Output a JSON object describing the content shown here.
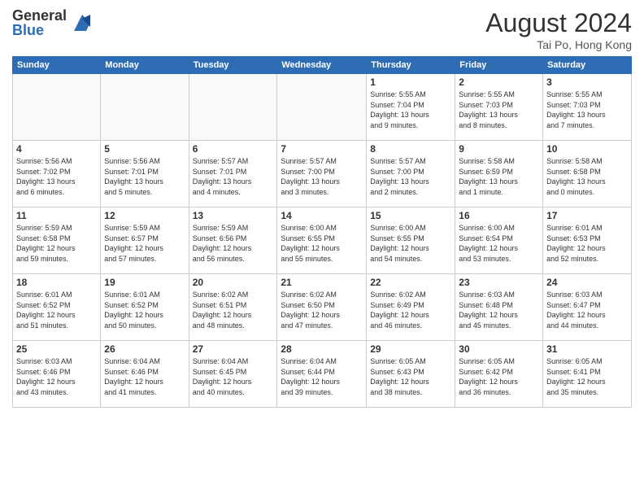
{
  "logo": {
    "general": "General",
    "blue": "Blue"
  },
  "title": {
    "month": "August 2024",
    "location": "Tai Po, Hong Kong"
  },
  "weekdays": [
    "Sunday",
    "Monday",
    "Tuesday",
    "Wednesday",
    "Thursday",
    "Friday",
    "Saturday"
  ],
  "weeks": [
    [
      {
        "day": "",
        "info": ""
      },
      {
        "day": "",
        "info": ""
      },
      {
        "day": "",
        "info": ""
      },
      {
        "day": "",
        "info": ""
      },
      {
        "day": "1",
        "info": "Sunrise: 5:55 AM\nSunset: 7:04 PM\nDaylight: 13 hours\nand 9 minutes."
      },
      {
        "day": "2",
        "info": "Sunrise: 5:55 AM\nSunset: 7:03 PM\nDaylight: 13 hours\nand 8 minutes."
      },
      {
        "day": "3",
        "info": "Sunrise: 5:55 AM\nSunset: 7:03 PM\nDaylight: 13 hours\nand 7 minutes."
      }
    ],
    [
      {
        "day": "4",
        "info": "Sunrise: 5:56 AM\nSunset: 7:02 PM\nDaylight: 13 hours\nand 6 minutes."
      },
      {
        "day": "5",
        "info": "Sunrise: 5:56 AM\nSunset: 7:01 PM\nDaylight: 13 hours\nand 5 minutes."
      },
      {
        "day": "6",
        "info": "Sunrise: 5:57 AM\nSunset: 7:01 PM\nDaylight: 13 hours\nand 4 minutes."
      },
      {
        "day": "7",
        "info": "Sunrise: 5:57 AM\nSunset: 7:00 PM\nDaylight: 13 hours\nand 3 minutes."
      },
      {
        "day": "8",
        "info": "Sunrise: 5:57 AM\nSunset: 7:00 PM\nDaylight: 13 hours\nand 2 minutes."
      },
      {
        "day": "9",
        "info": "Sunrise: 5:58 AM\nSunset: 6:59 PM\nDaylight: 13 hours\nand 1 minute."
      },
      {
        "day": "10",
        "info": "Sunrise: 5:58 AM\nSunset: 6:58 PM\nDaylight: 13 hours\nand 0 minutes."
      }
    ],
    [
      {
        "day": "11",
        "info": "Sunrise: 5:59 AM\nSunset: 6:58 PM\nDaylight: 12 hours\nand 59 minutes."
      },
      {
        "day": "12",
        "info": "Sunrise: 5:59 AM\nSunset: 6:57 PM\nDaylight: 12 hours\nand 57 minutes."
      },
      {
        "day": "13",
        "info": "Sunrise: 5:59 AM\nSunset: 6:56 PM\nDaylight: 12 hours\nand 56 minutes."
      },
      {
        "day": "14",
        "info": "Sunrise: 6:00 AM\nSunset: 6:55 PM\nDaylight: 12 hours\nand 55 minutes."
      },
      {
        "day": "15",
        "info": "Sunrise: 6:00 AM\nSunset: 6:55 PM\nDaylight: 12 hours\nand 54 minutes."
      },
      {
        "day": "16",
        "info": "Sunrise: 6:00 AM\nSunset: 6:54 PM\nDaylight: 12 hours\nand 53 minutes."
      },
      {
        "day": "17",
        "info": "Sunrise: 6:01 AM\nSunset: 6:53 PM\nDaylight: 12 hours\nand 52 minutes."
      }
    ],
    [
      {
        "day": "18",
        "info": "Sunrise: 6:01 AM\nSunset: 6:52 PM\nDaylight: 12 hours\nand 51 minutes."
      },
      {
        "day": "19",
        "info": "Sunrise: 6:01 AM\nSunset: 6:52 PM\nDaylight: 12 hours\nand 50 minutes."
      },
      {
        "day": "20",
        "info": "Sunrise: 6:02 AM\nSunset: 6:51 PM\nDaylight: 12 hours\nand 48 minutes."
      },
      {
        "day": "21",
        "info": "Sunrise: 6:02 AM\nSunset: 6:50 PM\nDaylight: 12 hours\nand 47 minutes."
      },
      {
        "day": "22",
        "info": "Sunrise: 6:02 AM\nSunset: 6:49 PM\nDaylight: 12 hours\nand 46 minutes."
      },
      {
        "day": "23",
        "info": "Sunrise: 6:03 AM\nSunset: 6:48 PM\nDaylight: 12 hours\nand 45 minutes."
      },
      {
        "day": "24",
        "info": "Sunrise: 6:03 AM\nSunset: 6:47 PM\nDaylight: 12 hours\nand 44 minutes."
      }
    ],
    [
      {
        "day": "25",
        "info": "Sunrise: 6:03 AM\nSunset: 6:46 PM\nDaylight: 12 hours\nand 43 minutes."
      },
      {
        "day": "26",
        "info": "Sunrise: 6:04 AM\nSunset: 6:46 PM\nDaylight: 12 hours\nand 41 minutes."
      },
      {
        "day": "27",
        "info": "Sunrise: 6:04 AM\nSunset: 6:45 PM\nDaylight: 12 hours\nand 40 minutes."
      },
      {
        "day": "28",
        "info": "Sunrise: 6:04 AM\nSunset: 6:44 PM\nDaylight: 12 hours\nand 39 minutes."
      },
      {
        "day": "29",
        "info": "Sunrise: 6:05 AM\nSunset: 6:43 PM\nDaylight: 12 hours\nand 38 minutes."
      },
      {
        "day": "30",
        "info": "Sunrise: 6:05 AM\nSunset: 6:42 PM\nDaylight: 12 hours\nand 36 minutes."
      },
      {
        "day": "31",
        "info": "Sunrise: 6:05 AM\nSunset: 6:41 PM\nDaylight: 12 hours\nand 35 minutes."
      }
    ]
  ]
}
